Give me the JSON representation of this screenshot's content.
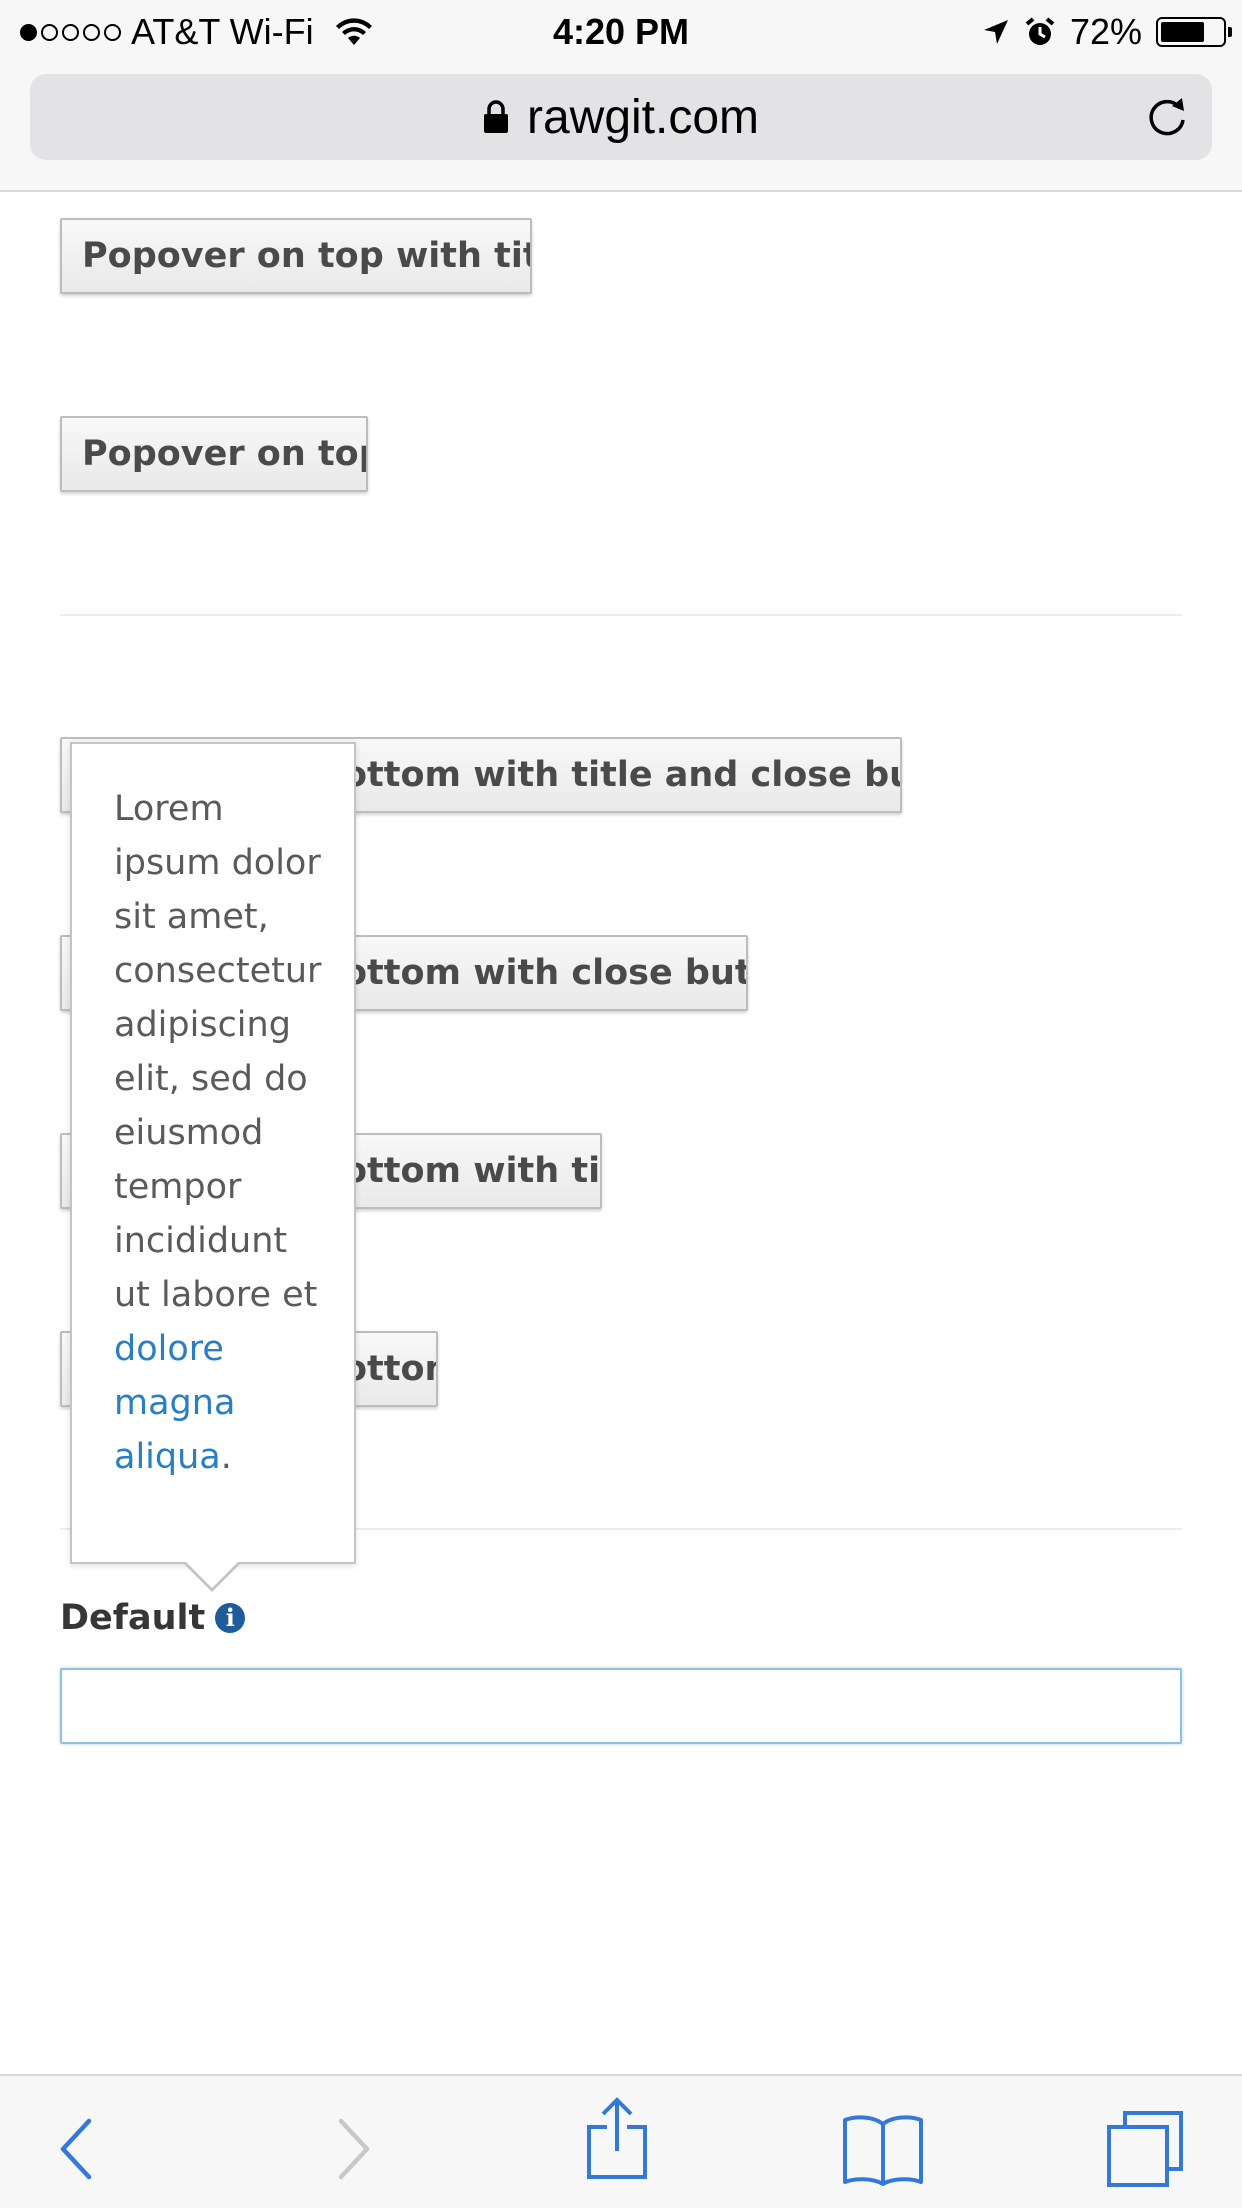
{
  "status_bar": {
    "carrier": "AT&T Wi-Fi",
    "time": "4:20 PM",
    "battery": "72%",
    "battery_level": 0.72
  },
  "url_bar": {
    "domain": "rawgit.com"
  },
  "content": {
    "buttons": {
      "top_with_title": "Popover on top with title",
      "top": "Popover on top",
      "bottom_title_close": "Popover on bottom with title and close button",
      "bottom_close": "Popover on bottom with close button",
      "bottom_title": "Popover on bottom with title",
      "bottom": "Popover on bottom"
    },
    "field_label": "Default",
    "field_value": ""
  },
  "popover": {
    "text_before_link": "Lorem ipsum dolor sit amet, consectetur adipiscing elit, sed do eiusmod tempor incididunt ut labore et",
    "link_text": "dolore magna aliqua",
    "text_after_link": "."
  },
  "icons": {
    "lock": "lock-icon",
    "reload": "reload-icon",
    "info": "info-icon",
    "wifi": "wifi-icon",
    "location": "location-arrow-icon",
    "alarm": "alarm-clock-icon",
    "back": "chevron-left-icon",
    "forward": "chevron-right-icon",
    "share": "share-icon",
    "bookmarks": "book-icon",
    "tabs": "tabs-icon"
  },
  "colors": {
    "accent": "#2a7ec2",
    "toolbar_tint": "#3478d8",
    "toolbar_disabled": "#c7c7cc",
    "info_icon": "#1f5d9a",
    "input_focus_border": "#8fc2dd"
  }
}
